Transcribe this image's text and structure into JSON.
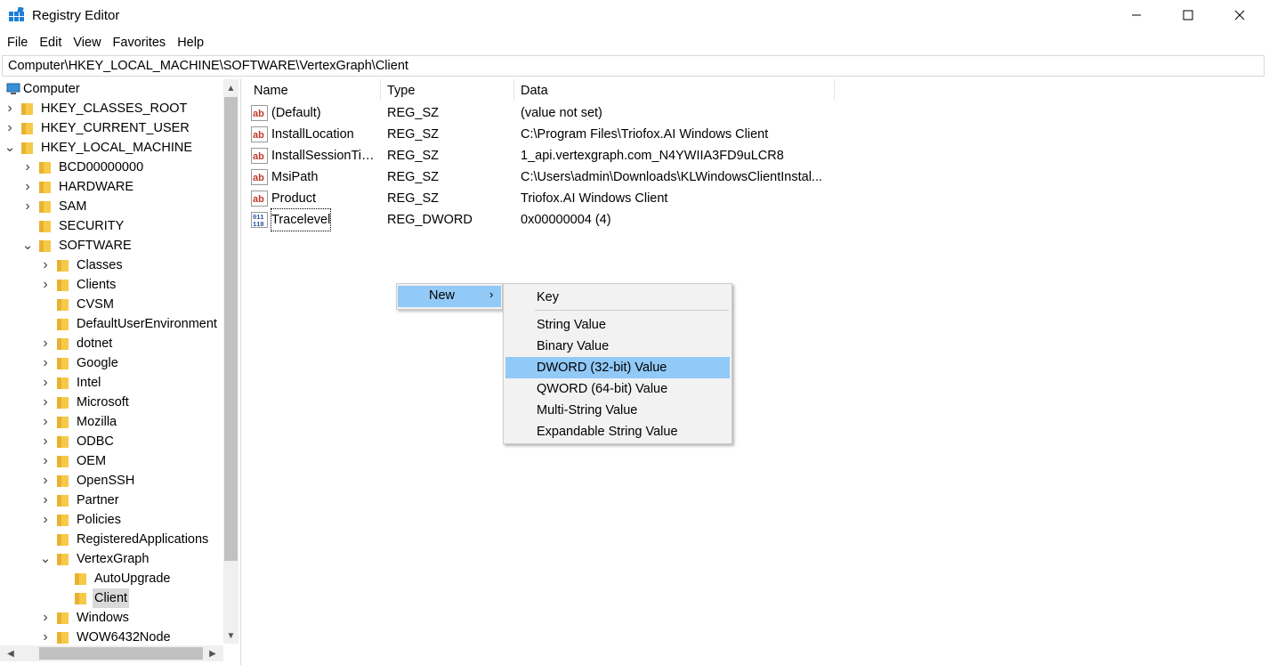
{
  "window": {
    "title": "Registry Editor"
  },
  "menu": [
    "File",
    "Edit",
    "View",
    "Favorites",
    "Help"
  ],
  "address": "Computer\\HKEY_LOCAL_MACHINE\\SOFTWARE\\VertexGraph\\Client",
  "tree": [
    {
      "label": "Computer",
      "type": "computer-icon"
    },
    {
      "label": "HKEY_CLASSES_ROOT",
      "chev": "right"
    },
    {
      "label": "HKEY_CURRENT_USER",
      "chev": "right"
    },
    {
      "label": "HKEY_LOCAL_MACHINE",
      "chev": "down"
    },
    {
      "label": "BCD00000000",
      "chev": "right"
    },
    {
      "label": "HARDWARE",
      "chev": "right"
    },
    {
      "label": "SAM",
      "chev": "right"
    },
    {
      "label": "SECURITY",
      "chev": "none"
    },
    {
      "label": "SOFTWARE",
      "chev": "down"
    },
    {
      "label": "Classes",
      "chev": "right"
    },
    {
      "label": "Clients",
      "chev": "right"
    },
    {
      "label": "CVSM",
      "chev": "none"
    },
    {
      "label": "DefaultUserEnvironment",
      "chev": "none"
    },
    {
      "label": "dotnet",
      "chev": "right"
    },
    {
      "label": "Google",
      "chev": "right"
    },
    {
      "label": "Intel",
      "chev": "right"
    },
    {
      "label": "Microsoft",
      "chev": "right"
    },
    {
      "label": "Mozilla",
      "chev": "right"
    },
    {
      "label": "ODBC",
      "chev": "right"
    },
    {
      "label": "OEM",
      "chev": "right"
    },
    {
      "label": "OpenSSH",
      "chev": "right"
    },
    {
      "label": "Partner",
      "chev": "right"
    },
    {
      "label": "Policies",
      "chev": "right"
    },
    {
      "label": "RegisteredApplications",
      "chev": "none"
    },
    {
      "label": "VertexGraph",
      "chev": "down"
    },
    {
      "label": "AutoUpgrade",
      "chev": "none"
    },
    {
      "label": "Client",
      "chev": "none",
      "selected": true
    },
    {
      "label": "Windows",
      "chev": "right"
    },
    {
      "label": "WOW6432Node",
      "chev": "right"
    }
  ],
  "columns": {
    "name": "Name",
    "type": "Type",
    "data": "Data"
  },
  "values": [
    {
      "name": "(Default)",
      "type": "REG_SZ",
      "data": "(value not set)",
      "icon": "string-value-icon"
    },
    {
      "name": "InstallLocation",
      "type": "REG_SZ",
      "data": "C:\\Program Files\\Triofox.AI Windows Client",
      "icon": "string-value-icon"
    },
    {
      "name": "InstallSessionTic...",
      "type": "REG_SZ",
      "data": "1_api.vertexgraph.com_N4YWIIA3FD9uLCR8",
      "icon": "string-value-icon"
    },
    {
      "name": "MsiPath",
      "type": "REG_SZ",
      "data": "C:\\Users\\admin\\Downloads\\KLWindowsClientInstal...",
      "icon": "string-value-icon"
    },
    {
      "name": "Product",
      "type": "REG_SZ",
      "data": "Triofox.AI Windows Client",
      "icon": "string-value-icon"
    },
    {
      "name": "Tracelevel",
      "type": "REG_DWORD",
      "data": "0x00000004 (4)",
      "icon": "dword-value-icon"
    }
  ],
  "context_menu": {
    "new_label": "New",
    "submenu": [
      "Key",
      "String Value",
      "Binary Value",
      "DWORD (32-bit) Value",
      "QWORD (64-bit) Value",
      "Multi-String Value",
      "Expandable String Value"
    ],
    "highlighted": "DWORD (32-bit) Value"
  },
  "colors": {
    "highlight": "#91c9f7",
    "folder": "#f7c948",
    "selection": "#d9d9d9"
  }
}
